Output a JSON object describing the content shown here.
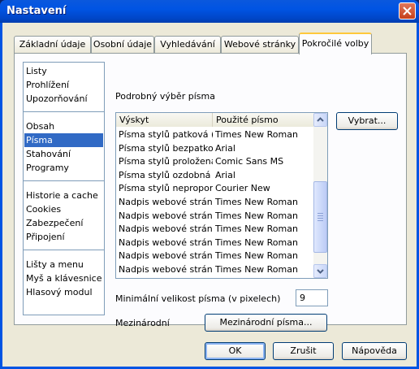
{
  "window": {
    "title": "Nastavení"
  },
  "tabs": [
    {
      "label": "Základní údaje"
    },
    {
      "label": "Osobní údaje"
    },
    {
      "label": "Vyhledávání"
    },
    {
      "label": "Webové stránky"
    },
    {
      "label": "Pokročilé volby"
    }
  ],
  "active_tab": "Pokročilé volby",
  "nav": {
    "groups": [
      [
        "Listy",
        "Prohlížení",
        "Upozorňování"
      ],
      [
        "Obsah",
        "Písma",
        "Stahování",
        "Programy"
      ],
      [
        "Historie a cache",
        "Cookies",
        "Zabezpečení",
        "Připojení"
      ],
      [
        "Lišty a menu",
        "Myš a klávesnice",
        "Hlasový modul"
      ]
    ],
    "selected": "Písma"
  },
  "fonts_panel": {
    "section_title": "Podrobný výběr písma",
    "columns": [
      "Výskyt",
      "Použité písmo"
    ],
    "rows": [
      [
        "Písma stylů patková (s...",
        "Times New Roman"
      ],
      [
        "Písma stylů bezpatkov...",
        "Arial"
      ],
      [
        "Písma stylů proložená ...",
        "Comic Sans MS"
      ],
      [
        "Písma stylů ozdobná (...",
        "Arial"
      ],
      [
        "Písma stylů neproporci...",
        "Courier New"
      ],
      [
        "Nadpis webové stránk...",
        "Times New Roman"
      ],
      [
        "Nadpis webové stránk...",
        "Times New Roman"
      ],
      [
        "Nadpis webové stránk...",
        "Times New Roman"
      ],
      [
        "Nadpis webové stránk...",
        "Times New Roman"
      ],
      [
        "Nadpis webové stránk...",
        "Times New Roman"
      ],
      [
        "Nadpis webové stránk...",
        "Times New Roman"
      ]
    ],
    "choose_button": "Vybrat...",
    "min_size_label": "Minimální velikost písma (v pixelech)",
    "min_size_value": "9",
    "international_label": "Mezinárodní",
    "international_button": "Mezinárodní písma..."
  },
  "dialog_buttons": {
    "ok": "OK",
    "cancel": "Zrušit",
    "help": "Nápověda"
  },
  "colors": {
    "title_blue": "#0054e3",
    "face": "#ece9d8",
    "selection": "#316ac5",
    "active_tab_accent": "#ffc83c"
  }
}
